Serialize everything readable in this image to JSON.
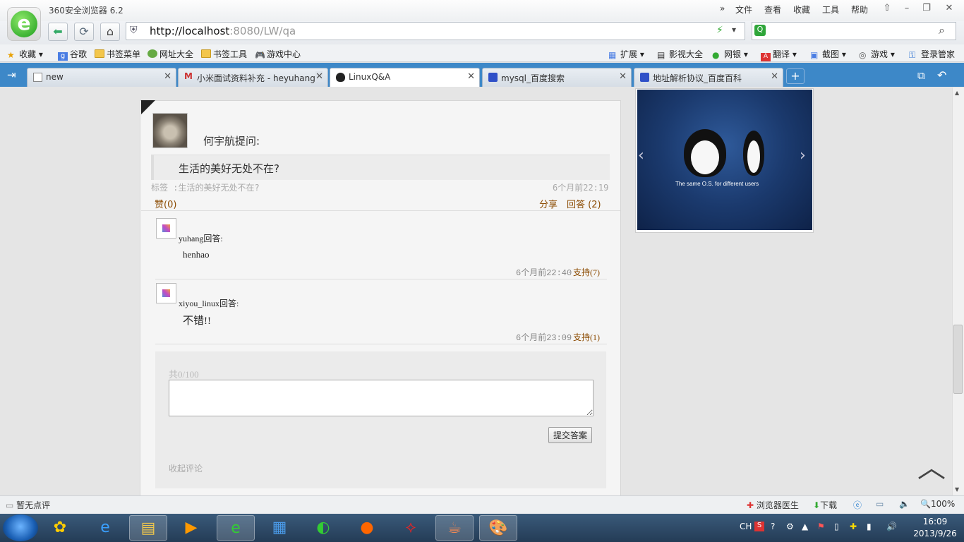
{
  "browser": {
    "title": "360安全浏览器 6.2",
    "menu": [
      "文件",
      "查看",
      "收藏",
      "工具",
      "帮助"
    ],
    "url_host": "http://localhost",
    "url_rest": ":8080/LW/qa"
  },
  "bookmarks": [
    "收藏",
    "谷歌",
    "书签菜单",
    "网址大全",
    "书签工具",
    "游戏中心"
  ],
  "toolbar_right": [
    "扩展",
    "影视大全",
    "网银",
    "翻译",
    "截图",
    "游戏",
    "登录管家"
  ],
  "tabs": [
    {
      "label": "new"
    },
    {
      "label": "小米面试资料补充 - heyuhang"
    },
    {
      "label": "LinuxQ&A"
    },
    {
      "label": "mysql_百度搜索"
    },
    {
      "label": "地址解析协议_百度百科"
    }
  ],
  "question": {
    "asker": "何宇航提问:",
    "text": "生活的美好无处不在?",
    "tags": "标签 :生活的美好无处不在?",
    "time": "6个月前22:19",
    "like": "赞(0)",
    "share": "分享",
    "answer": "回答 (2)"
  },
  "answers": [
    {
      "user": "yuhang回答:",
      "text": "henhao",
      "time": "6个月前22:40",
      "support": "支持(7)"
    },
    {
      "user": "xiyou_linux回答:",
      "text": "不错!!",
      "time": "6个月前23:09",
      "support": "支持(1)"
    }
  ],
  "reply": {
    "counter": "共0/100",
    "submit": "提交答案",
    "collapse": "收起评论"
  },
  "carousel": {
    "caption": "The same O.S. for different users"
  },
  "statusbar": {
    "left": "暂无点评",
    "doctor": "浏览器医生",
    "download": "下载",
    "zoom": "100%"
  },
  "taskbar": {
    "lang": "CH",
    "time": "16:09",
    "date": "2013/9/26"
  }
}
